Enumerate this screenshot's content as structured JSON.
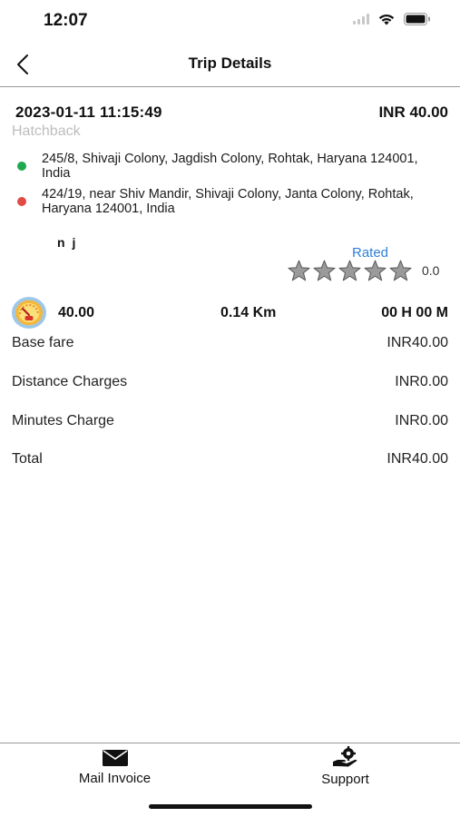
{
  "status_bar": {
    "time": "12:07"
  },
  "nav": {
    "title": "Trip Details"
  },
  "trip": {
    "datetime": "2023-01-11 11:15:49",
    "amount": "INR 40.00",
    "vehicle_type": "Hatchback",
    "pickup": {
      "address": "245/8, Shivaji Colony, Jagdish Colony, Rohtak, Haryana 124001, India",
      "color": "#1fa84f"
    },
    "drop": {
      "address": "424/19, near Shiv Mandir, Shivaji Colony, Janta Colony, Rohtak, Haryana 124001, India",
      "color": "#e04b45"
    }
  },
  "driver": {
    "name": "n j",
    "rating_status": "Rated",
    "rating_value": "0.0",
    "stars_total": 5,
    "stars_filled": 0
  },
  "summary": {
    "fare": "40.00",
    "distance": "0.14 Km",
    "duration": "00 H 00 M"
  },
  "fare_breakdown": [
    {
      "label": "Base fare",
      "value": "INR40.00"
    },
    {
      "label": "Distance Charges",
      "value": "INR0.00"
    },
    {
      "label": "Minutes Charge",
      "value": "INR0.00"
    },
    {
      "label": "Total",
      "value": "INR40.00"
    }
  ],
  "bottom_tabs": [
    {
      "label": "Mail Invoice",
      "icon": "mail-icon"
    },
    {
      "label": "Support",
      "icon": "support-icon"
    }
  ],
  "colors": {
    "accent_blue": "#2f7fd8",
    "star_gray": "#9a9a9a",
    "muted_text": "#bdbdbd"
  }
}
